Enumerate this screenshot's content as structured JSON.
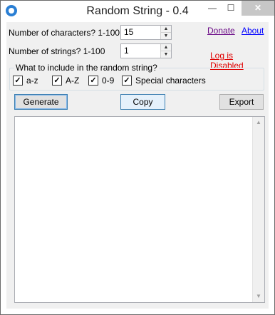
{
  "window": {
    "title": "Random String - 0.4",
    "minimize_glyph": "—",
    "maximize_glyph": "☐",
    "close_glyph": "✕"
  },
  "form": {
    "num_chars_label": "Number of characters? 1-100",
    "num_chars_value": "15",
    "num_strings_label": "Number of strings? 1-100",
    "num_strings_value": "1"
  },
  "links": {
    "donate": "Donate",
    "about": "About",
    "log_status": "Log is Disabled"
  },
  "include_group": {
    "title": "What to include in the random string?",
    "options": [
      {
        "label": "a-z",
        "checked": true
      },
      {
        "label": "A-Z",
        "checked": true
      },
      {
        "label": "0-9",
        "checked": true
      },
      {
        "label": "Special characters",
        "checked": true
      }
    ]
  },
  "buttons": {
    "generate": "Generate",
    "copy": "Copy",
    "export": "Export"
  },
  "output": {
    "text": ""
  },
  "icons": {
    "spin_up": "▲",
    "spin_down": "▼",
    "check": "✓",
    "scroll_up": "▲",
    "scroll_down": "▼"
  },
  "colors": {
    "link_purple": "#6b0b87",
    "link_blue": "#0000ff",
    "log_red": "#e00000",
    "accent": "#3c7fb1"
  }
}
